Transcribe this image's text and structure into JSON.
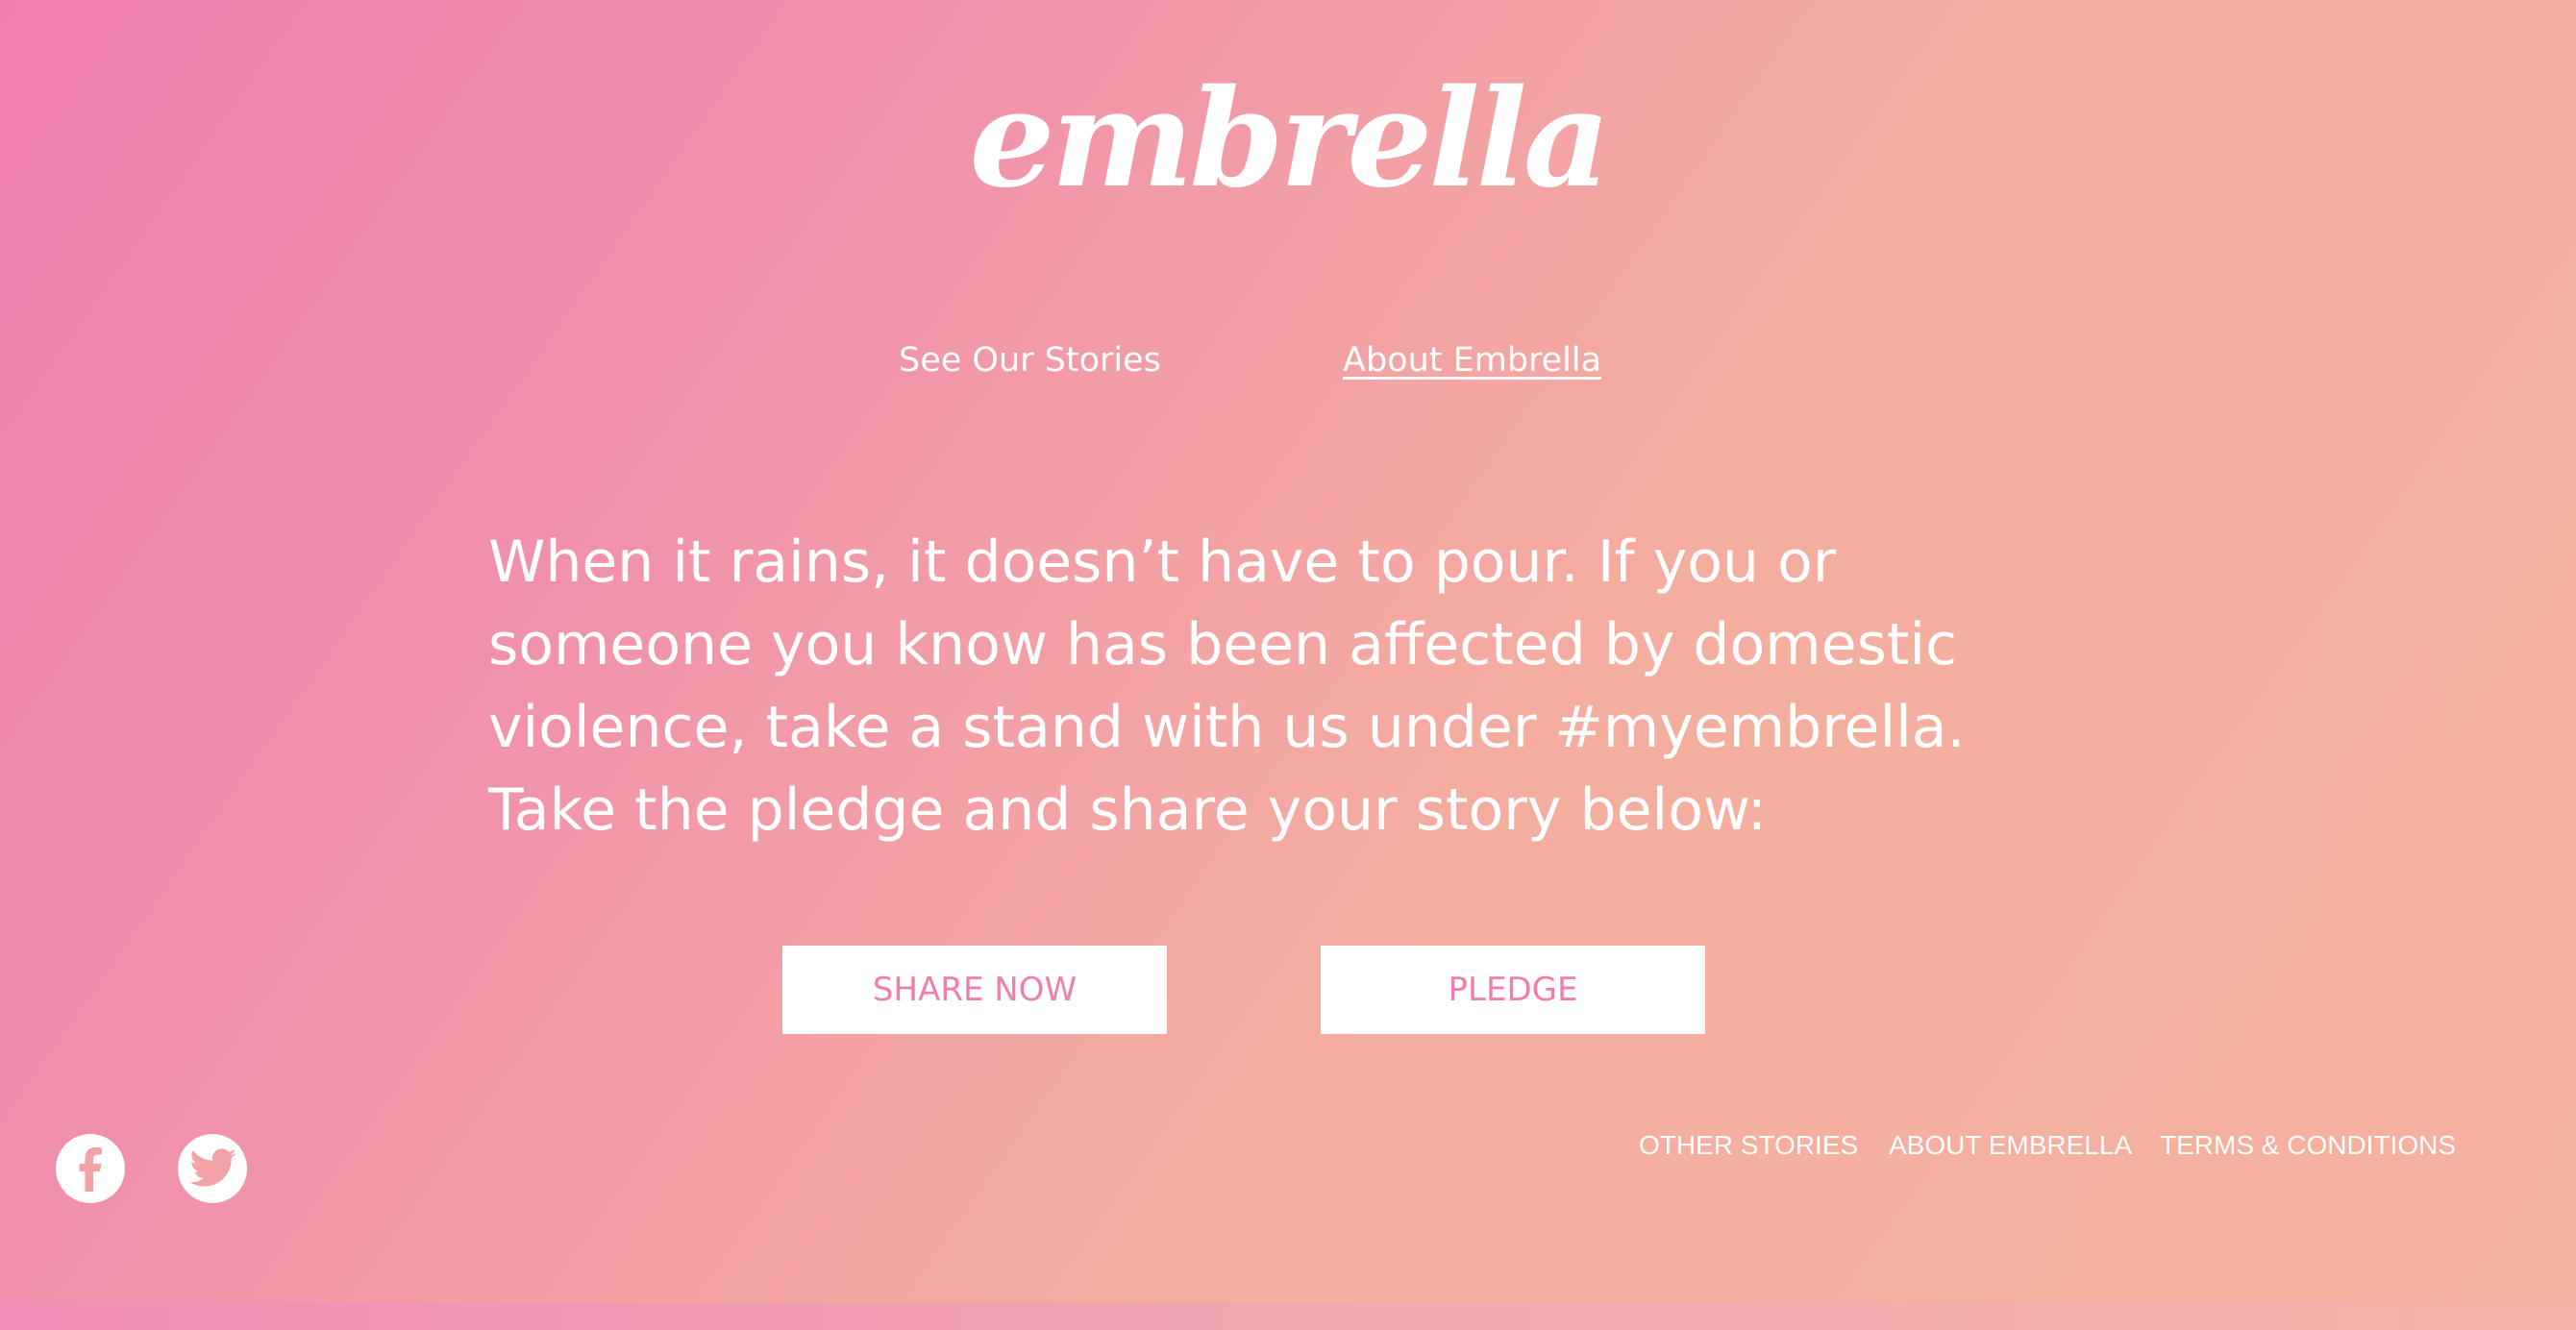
{
  "brand": {
    "logo_text": "embrella"
  },
  "nav": {
    "stories_label": "See Our Stories",
    "about_label": "About Embrella"
  },
  "intro": {
    "text": "When it rains, it doesn’t have to pour. If you or someone you know has been affected by domestic violence, take a stand with us under #myembrella. Take the pledge and share your story below:"
  },
  "actions": {
    "share_label": "SHARE NOW",
    "pledge_label": "PLEDGE"
  },
  "social": {
    "facebook_icon": "facebook-icon",
    "twitter_icon": "twitter-icon"
  },
  "footer": {
    "other_stories_label": "OTHER STORIES",
    "about_label": "ABOUT EMBRELLA",
    "terms_label": "TERMS & CONDITIONS"
  },
  "colors": {
    "gradient_start": "#f07fb0",
    "gradient_end": "#f5b19f",
    "button_text": "#ee7eb0",
    "text": "#ffffff"
  }
}
